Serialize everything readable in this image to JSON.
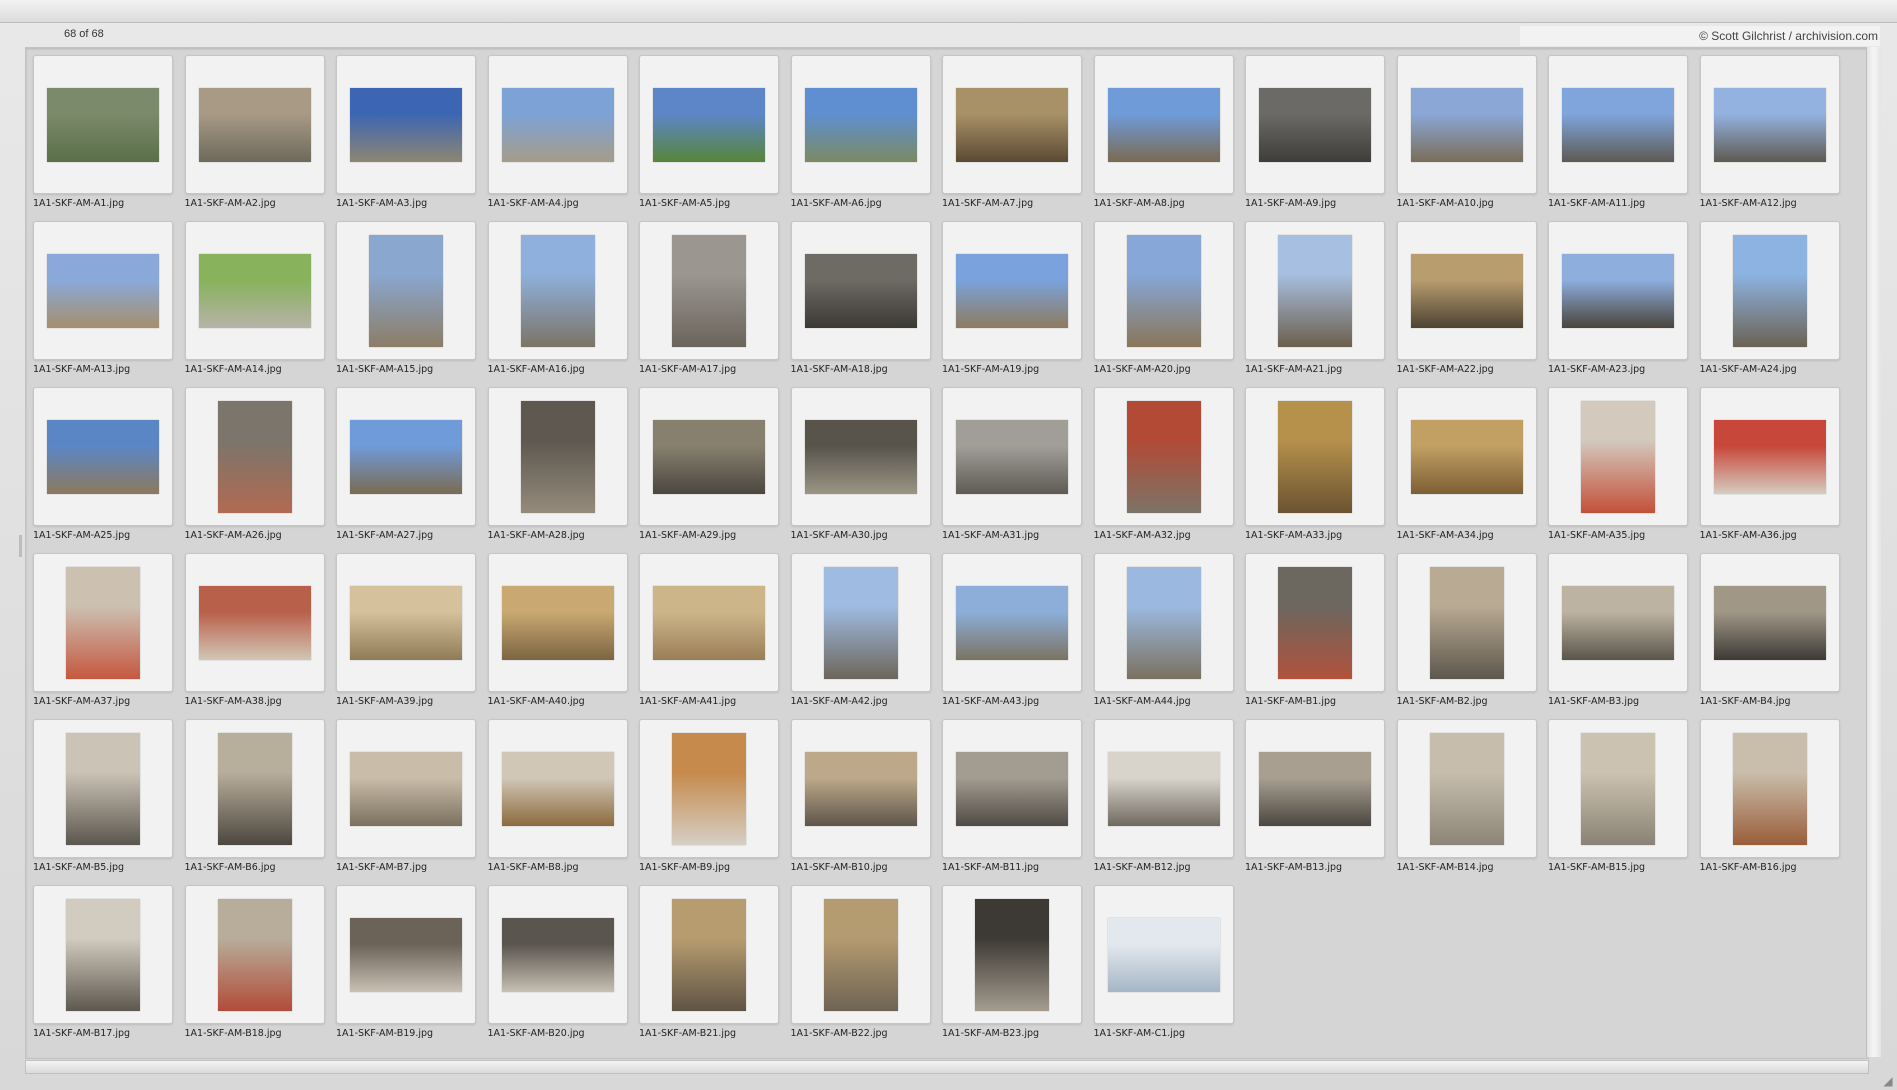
{
  "header": {
    "count": "68 of 68",
    "credit": "© Scott Gilchrist / archivision.com"
  },
  "thumbnails": [
    {
      "name": "1A1-SKF-AM-A1.jpg",
      "orient": "land",
      "colors": [
        "#7a8a6a",
        "#5b6f4a"
      ]
    },
    {
      "name": "1A1-SKF-AM-A2.jpg",
      "orient": "land",
      "colors": [
        "#a89a85",
        "#6d6a5c"
      ]
    },
    {
      "name": "1A1-SKF-AM-A3.jpg",
      "orient": "land",
      "colors": [
        "#3c66b3",
        "#8d8672"
      ]
    },
    {
      "name": "1A1-SKF-AM-A4.jpg",
      "orient": "land",
      "colors": [
        "#7da2d6",
        "#a59c8a"
      ]
    },
    {
      "name": "1A1-SKF-AM-A5.jpg",
      "orient": "land",
      "colors": [
        "#5d86c8",
        "#56853a"
      ]
    },
    {
      "name": "1A1-SKF-AM-A6.jpg",
      "orient": "land",
      "colors": [
        "#5f8fd0",
        "#7b8a63"
      ]
    },
    {
      "name": "1A1-SKF-AM-A7.jpg",
      "orient": "land",
      "colors": [
        "#a89167",
        "#5b4a34"
      ]
    },
    {
      "name": "1A1-SKF-AM-A8.jpg",
      "orient": "land",
      "colors": [
        "#6f9bd9",
        "#7a6a52"
      ]
    },
    {
      "name": "1A1-SKF-AM-A9.jpg",
      "orient": "land",
      "colors": [
        "#6b6a66",
        "#3f3d39"
      ]
    },
    {
      "name": "1A1-SKF-AM-A10.jpg",
      "orient": "land",
      "colors": [
        "#8aa7d6",
        "#7a6d58"
      ]
    },
    {
      "name": "1A1-SKF-AM-A11.jpg",
      "orient": "land",
      "colors": [
        "#7fa5dc",
        "#5e5a54"
      ]
    },
    {
      "name": "1A1-SKF-AM-A12.jpg",
      "orient": "land",
      "colors": [
        "#94b2e0",
        "#5f5a52"
      ]
    },
    {
      "name": "1A1-SKF-AM-A13.jpg",
      "orient": "land",
      "colors": [
        "#8aa9da",
        "#a58f6c"
      ]
    },
    {
      "name": "1A1-SKF-AM-A14.jpg",
      "orient": "land",
      "colors": [
        "#88b25c",
        "#b7b3a8"
      ]
    },
    {
      "name": "1A1-SKF-AM-A15.jpg",
      "orient": "port",
      "colors": [
        "#8aa7d0",
        "#8c7d66"
      ]
    },
    {
      "name": "1A1-SKF-AM-A16.jpg",
      "orient": "port",
      "colors": [
        "#8fb0dc",
        "#7b7466"
      ]
    },
    {
      "name": "1A1-SKF-AM-A17.jpg",
      "orient": "port",
      "colors": [
        "#9b9690",
        "#6a645c"
      ]
    },
    {
      "name": "1A1-SKF-AM-A18.jpg",
      "orient": "land",
      "colors": [
        "#6e6a64",
        "#3b3935"
      ]
    },
    {
      "name": "1A1-SKF-AM-A19.jpg",
      "orient": "land",
      "colors": [
        "#7aa2dc",
        "#8d7b5e"
      ]
    },
    {
      "name": "1A1-SKF-AM-A20.jpg",
      "orient": "port",
      "colors": [
        "#86a7d8",
        "#8a7659"
      ]
    },
    {
      "name": "1A1-SKF-AM-A21.jpg",
      "orient": "port",
      "colors": [
        "#a7bfe0",
        "#6c5f4c"
      ]
    },
    {
      "name": "1A1-SKF-AM-A22.jpg",
      "orient": "land",
      "colors": [
        "#b89d6f",
        "#4d4233"
      ]
    },
    {
      "name": "1A1-SKF-AM-A23.jpg",
      "orient": "land",
      "colors": [
        "#8eaede",
        "#4a443b"
      ]
    },
    {
      "name": "1A1-SKF-AM-A24.jpg",
      "orient": "port",
      "colors": [
        "#8db3e2",
        "#6b6253"
      ]
    },
    {
      "name": "1A1-SKF-AM-A25.jpg",
      "orient": "land",
      "colors": [
        "#5b86c6",
        "#8c7a5c"
      ]
    },
    {
      "name": "1A1-SKF-AM-A26.jpg",
      "orient": "port",
      "colors": [
        "#7b756b",
        "#b26a52"
      ]
    },
    {
      "name": "1A1-SKF-AM-A27.jpg",
      "orient": "land",
      "colors": [
        "#6f9bd8",
        "#7b6b52"
      ]
    },
    {
      "name": "1A1-SKF-AM-A28.jpg",
      "orient": "port",
      "colors": [
        "#5e5850",
        "#958b7c"
      ]
    },
    {
      "name": "1A1-SKF-AM-A29.jpg",
      "orient": "land",
      "colors": [
        "#87806f",
        "#4b4740"
      ]
    },
    {
      "name": "1A1-SKF-AM-A30.jpg",
      "orient": "land",
      "colors": [
        "#58544c",
        "#9b9585"
      ]
    },
    {
      "name": "1A1-SKF-AM-A31.jpg",
      "orient": "land",
      "colors": [
        "#a19e98",
        "#5e5b55"
      ]
    },
    {
      "name": "1A1-SKF-AM-A32.jpg",
      "orient": "port",
      "colors": [
        "#b24a35",
        "#7c7468"
      ]
    },
    {
      "name": "1A1-SKF-AM-A33.jpg",
      "orient": "port",
      "colors": [
        "#b6914c",
        "#6b5331"
      ]
    },
    {
      "name": "1A1-SKF-AM-A34.jpg",
      "orient": "land",
      "colors": [
        "#c2a064",
        "#7c5f33"
      ]
    },
    {
      "name": "1A1-SKF-AM-A35.jpg",
      "orient": "port",
      "colors": [
        "#d3c9bd",
        "#c4503a"
      ]
    },
    {
      "name": "1A1-SKF-AM-A36.jpg",
      "orient": "land",
      "colors": [
        "#c7473a",
        "#d6ccc0"
      ]
    },
    {
      "name": "1A1-SKF-AM-A37.jpg",
      "orient": "port",
      "colors": [
        "#ccc0b1",
        "#c55840"
      ]
    },
    {
      "name": "1A1-SKF-AM-A38.jpg",
      "orient": "land",
      "colors": [
        "#b9604b",
        "#d2c6b5"
      ]
    },
    {
      "name": "1A1-SKF-AM-A39.jpg",
      "orient": "land",
      "colors": [
        "#d5c29c",
        "#8f7b57"
      ]
    },
    {
      "name": "1A1-SKF-AM-A40.jpg",
      "orient": "land",
      "colors": [
        "#c9a971",
        "#7c6543"
      ]
    },
    {
      "name": "1A1-SKF-AM-A41.jpg",
      "orient": "land",
      "colors": [
        "#cdb58a",
        "#9a7f56"
      ]
    },
    {
      "name": "1A1-SKF-AM-A42.jpg",
      "orient": "port",
      "colors": [
        "#9fbbe2",
        "#6d665a"
      ]
    },
    {
      "name": "1A1-SKF-AM-A43.jpg",
      "orient": "land",
      "colors": [
        "#8caed9",
        "#7b7362"
      ]
    },
    {
      "name": "1A1-SKF-AM-A44.jpg",
      "orient": "port",
      "colors": [
        "#9bb9e0",
        "#7b7160"
      ]
    },
    {
      "name": "1A1-SKF-AM-B1.jpg",
      "orient": "port",
      "colors": [
        "#6c675f",
        "#b1523c"
      ]
    },
    {
      "name": "1A1-SKF-AM-B2.jpg",
      "orient": "port",
      "colors": [
        "#b8aa93",
        "#5d574d"
      ]
    },
    {
      "name": "1A1-SKF-AM-B3.jpg",
      "orient": "land",
      "colors": [
        "#bdb3a3",
        "#5a5449"
      ]
    },
    {
      "name": "1A1-SKF-AM-B4.jpg",
      "orient": "land",
      "colors": [
        "#a09787",
        "#3d3a35"
      ]
    },
    {
      "name": "1A1-SKF-AM-B5.jpg",
      "orient": "port",
      "colors": [
        "#cbc3b5",
        "#5b564e"
      ]
    },
    {
      "name": "1A1-SKF-AM-B6.jpg",
      "orient": "port",
      "colors": [
        "#b8ae9c",
        "#4c473f"
      ]
    },
    {
      "name": "1A1-SKF-AM-B7.jpg",
      "orient": "land",
      "colors": [
        "#c9bda9",
        "#7b705f"
      ]
    },
    {
      "name": "1A1-SKF-AM-B8.jpg",
      "orient": "land",
      "colors": [
        "#d1c7b7",
        "#8c6a3e"
      ]
    },
    {
      "name": "1A1-SKF-AM-B9.jpg",
      "orient": "port",
      "colors": [
        "#c58a4c",
        "#d6cfc5"
      ]
    },
    {
      "name": "1A1-SKF-AM-B10.jpg",
      "orient": "land",
      "colors": [
        "#bda98a",
        "#5e554a"
      ]
    },
    {
      "name": "1A1-SKF-AM-B11.jpg",
      "orient": "land",
      "colors": [
        "#a39c90",
        "#4f4b45"
      ]
    },
    {
      "name": "1A1-SKF-AM-B12.jpg",
      "orient": "land",
      "colors": [
        "#d8d4cc",
        "#6f695f"
      ]
    },
    {
      "name": "1A1-SKF-AM-B13.jpg",
      "orient": "land",
      "colors": [
        "#a89f91",
        "#4b4741"
      ]
    },
    {
      "name": "1A1-SKF-AM-B14.jpg",
      "orient": "port",
      "colors": [
        "#c6bdad",
        "#8c8577"
      ]
    },
    {
      "name": "1A1-SKF-AM-B15.jpg",
      "orient": "port",
      "colors": [
        "#cbc2b1",
        "#8a8274"
      ]
    },
    {
      "name": "1A1-SKF-AM-B16.jpg",
      "orient": "port",
      "colors": [
        "#c9beac",
        "#9b5d3a"
      ]
    },
    {
      "name": "1A1-SKF-AM-B17.jpg",
      "orient": "port",
      "colors": [
        "#d2cbbf",
        "#5d584f"
      ]
    },
    {
      "name": "1A1-SKF-AM-B18.jpg",
      "orient": "port",
      "colors": [
        "#b8ad9b",
        "#b24c39"
      ]
    },
    {
      "name": "1A1-SKF-AM-B19.jpg",
      "orient": "land",
      "colors": [
        "#6b6258",
        "#c9c1b4"
      ]
    },
    {
      "name": "1A1-SKF-AM-B20.jpg",
      "orient": "land",
      "colors": [
        "#5a554e",
        "#c7c0b3"
      ]
    },
    {
      "name": "1A1-SKF-AM-B21.jpg",
      "orient": "port",
      "colors": [
        "#b79c6f",
        "#5f5445"
      ]
    },
    {
      "name": "1A1-SKF-AM-B22.jpg",
      "orient": "port",
      "colors": [
        "#b59b70",
        "#6e6354"
      ]
    },
    {
      "name": "1A1-SKF-AM-B23.jpg",
      "orient": "port",
      "colors": [
        "#3d3a35",
        "#a49c8f"
      ]
    },
    {
      "name": "1A1-SKF-AM-C1.jpg",
      "orient": "land",
      "colors": [
        "#e3e8ee",
        "#a6b6c6"
      ]
    }
  ]
}
